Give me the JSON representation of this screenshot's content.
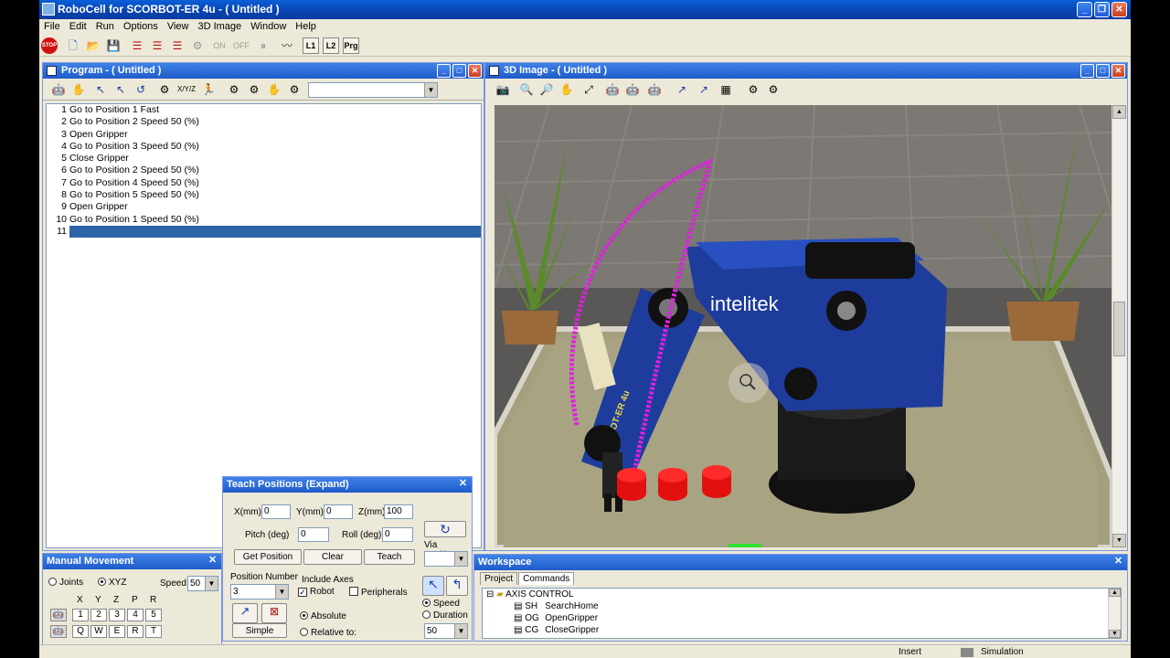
{
  "app": {
    "title": "RoboCell for SCORBOT-ER 4u - ( Untitled )"
  },
  "menu": [
    "File",
    "Edit",
    "Run",
    "Options",
    "View",
    "3D Image",
    "Window",
    "Help"
  ],
  "toolbar": {
    "stop_label": "STOP",
    "on_label": "ON",
    "off_label": "OFF",
    "l1_label": "L1",
    "l2_label": "L2",
    "prg_label": "Prg"
  },
  "program": {
    "title": "Program -  ( Untitled )",
    "lines": [
      {
        "num": "1",
        "cmd": "Go to Position 1 Fast"
      },
      {
        "num": "2",
        "cmd": "Go to Position 2 Speed 50 (%)"
      },
      {
        "num": "3",
        "cmd": "Open Gripper"
      },
      {
        "num": "4",
        "cmd": "Go to Position 3 Speed 50 (%)"
      },
      {
        "num": "5",
        "cmd": "Close Gripper"
      },
      {
        "num": "6",
        "cmd": "Go to Position 2 Speed 50 (%)"
      },
      {
        "num": "7",
        "cmd": "Go to Position 4 Speed 50 (%)"
      },
      {
        "num": "8",
        "cmd": "Go to Position 5 Speed 50 (%)"
      },
      {
        "num": "9",
        "cmd": "Open Gripper"
      },
      {
        "num": "10",
        "cmd": "Go to Position 1 Speed 50 (%)"
      },
      {
        "num": "11",
        "cmd": ""
      }
    ],
    "xyz_label": "X/Y/Z"
  },
  "image3d": {
    "title": "3D Image -  ( Untitled )",
    "brand_text": "intelitek",
    "arm_text": "SCORBOT-ER 4u"
  },
  "manual": {
    "title": "Manual Movement",
    "joints_label": "Joints",
    "xyz_label": "XYZ",
    "speed_label": "Speed:",
    "speed_value": "50",
    "axis_headers": [
      "X",
      "Y",
      "Z",
      "P",
      "R"
    ],
    "row1_keys": [
      "1",
      "2",
      "3",
      "4",
      "5"
    ],
    "row2_keys": [
      "Q",
      "W",
      "E",
      "R",
      "T"
    ]
  },
  "teach": {
    "title": "Teach Positions (Expand)",
    "x_label": "X(mm)",
    "x_value": "0",
    "y_label": "Y(mm)",
    "y_value": "0",
    "z_label": "Z(mm)",
    "z_value": "100",
    "pitch_label": "Pitch (deg)",
    "pitch_value": "0",
    "roll_label": "Roll (deg)",
    "roll_value": "0",
    "get_position": "Get Position",
    "clear": "Clear",
    "teach": "Teach",
    "via_position": "Via Position",
    "position_number_label": "Position Number",
    "position_number_value": "3",
    "include_axes_label": "Include Axes",
    "robot_label": "Robot",
    "peripherals_label": "Peripherals",
    "absolute_label": "Absolute",
    "relative_label": "Relative to:",
    "simple_label": "Simple",
    "speed_label": "Speed",
    "duration_label": "Duration",
    "speed_value": "50"
  },
  "workspace": {
    "title": "Workspace",
    "tabs": [
      "Project",
      "Commands"
    ],
    "root": "AXIS CONTROL",
    "items": [
      {
        "code": "SH",
        "name": "SearchHome"
      },
      {
        "code": "OG",
        "name": "OpenGripper"
      },
      {
        "code": "CG",
        "name": "CloseGripper"
      }
    ]
  },
  "status": {
    "insert": "Insert",
    "mode": "Simulation"
  },
  "colors": {
    "titlebar": "#0842B0",
    "selection": "#2F63A8",
    "robot_blue": "#1E3C9C",
    "trajectory": "#E020E0"
  }
}
